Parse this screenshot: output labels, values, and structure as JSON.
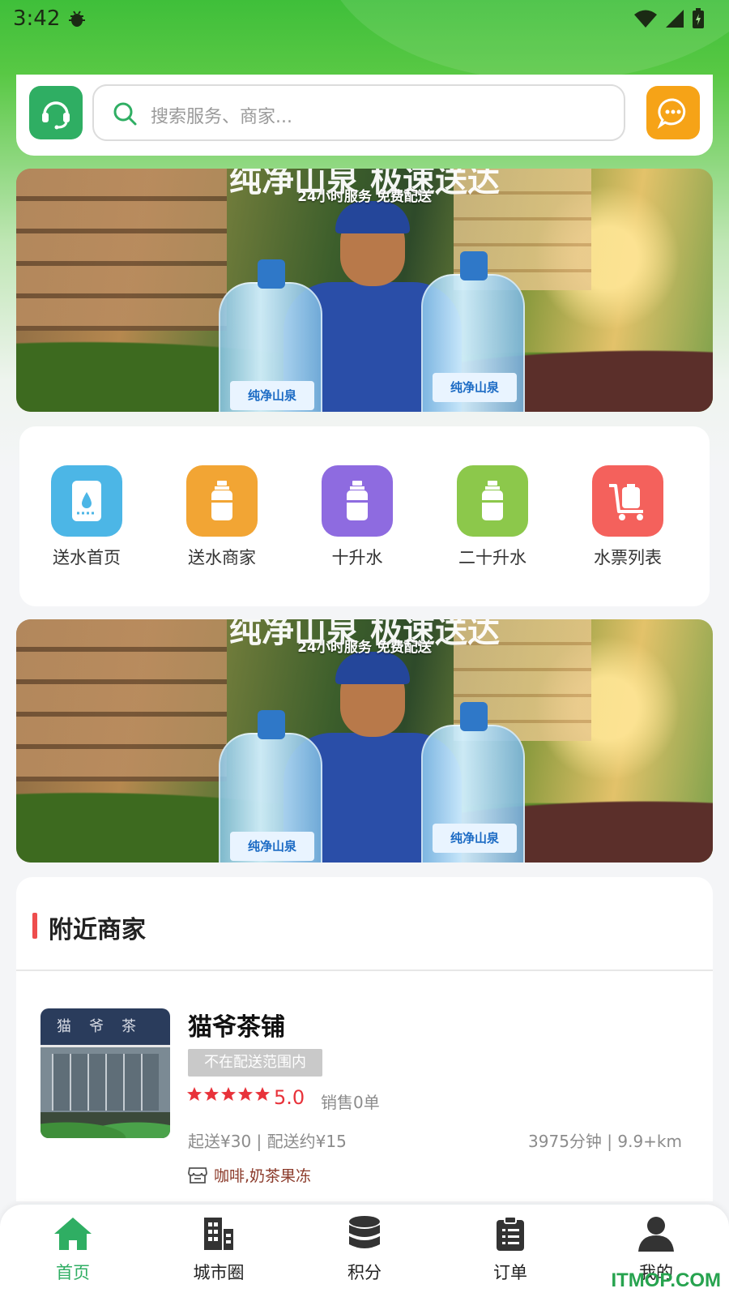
{
  "status_bar": {
    "time": "3:42"
  },
  "search": {
    "placeholder": "搜索服务、商家..."
  },
  "banner": {
    "headline": "纯净山泉 极速送达",
    "subline": "24小时服务 免费配送",
    "bottle_label": "纯净山泉"
  },
  "menu": {
    "items": [
      {
        "label": "送水首页",
        "color": "#4cb6e6",
        "icon": "water-dispenser-icon"
      },
      {
        "label": "送水商家",
        "color": "#f2a534",
        "icon": "bottle-icon"
      },
      {
        "label": "十升水",
        "color": "#8e6be0",
        "icon": "bottle-icon"
      },
      {
        "label": "二十升水",
        "color": "#8cc84b",
        "icon": "bottle-icon"
      },
      {
        "label": "水票列表",
        "color": "#f4615c",
        "icon": "cart-icon"
      }
    ]
  },
  "nearby": {
    "title": "附近商家",
    "shops": [
      {
        "name": "猫爷茶铺",
        "badge": "不在配送范围内",
        "rating": "5.0",
        "stars": 5,
        "sales": "销售0单",
        "delivery": "起送¥30 | 配送约¥15",
        "distance": "3975分钟 | 9.9+km",
        "category": "咖啡,奶茶果冻",
        "sign": "猫爷茶"
      }
    ]
  },
  "bottom_nav": {
    "items": [
      {
        "label": "首页",
        "icon": "home-icon",
        "active": true
      },
      {
        "label": "城市圈",
        "icon": "building-icon",
        "active": false
      },
      {
        "label": "积分",
        "icon": "database-icon",
        "active": false
      },
      {
        "label": "订单",
        "icon": "clipboard-icon",
        "active": false
      },
      {
        "label": "我的",
        "icon": "user-icon",
        "active": false
      }
    ]
  },
  "colors": {
    "accent": "#2fae63",
    "price_red": "#e8323a",
    "section_bar": "#ee4d4d"
  },
  "watermark": "ITMOP.COM"
}
